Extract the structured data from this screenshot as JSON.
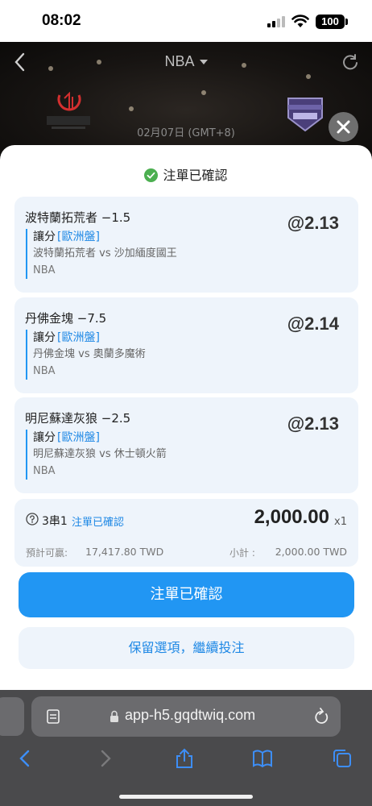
{
  "status": {
    "time": "08:02",
    "battery": "100"
  },
  "header": {
    "league": "NBA",
    "date": "02月07日 (GMT+8)"
  },
  "sheet": {
    "title": "注單已確認"
  },
  "bets": [
    {
      "title": "波特蘭拓荒者 −1.5",
      "odds": "@2.13",
      "type": "讓分",
      "market": "[歐洲盤]",
      "teams": "波特蘭拓荒者 vs 沙加緬度國王",
      "league": "NBA"
    },
    {
      "title": "丹佛金塊 −7.5",
      "odds": "@2.14",
      "type": "讓分",
      "market": "[歐洲盤]",
      "teams": "丹佛金塊 vs 奧蘭多魔術",
      "league": "NBA"
    },
    {
      "title": "明尼蘇達灰狼 −2.5",
      "odds": "@2.13",
      "type": "讓分",
      "market": "[歐洲盤]",
      "teams": "明尼蘇達灰狼 vs 休士頓火箭",
      "league": "NBA"
    }
  ],
  "summary": {
    "combo": "3串1",
    "status": "注單已確認",
    "amount": "2,000.00",
    "multiplier": "x1",
    "win_label": "預計可贏:",
    "win_value": "17,417.80 TWD",
    "subtotal_label": "小計 :",
    "subtotal_value": "2,000.00 TWD"
  },
  "buttons": {
    "confirm": "注單已確認",
    "keep": "保留選項，繼續投注"
  },
  "browser": {
    "url": "app-h5.gqdtwiq.com"
  },
  "colors": {
    "accent": "#2196f3",
    "card": "#eef4fb",
    "success": "#4caf50"
  }
}
